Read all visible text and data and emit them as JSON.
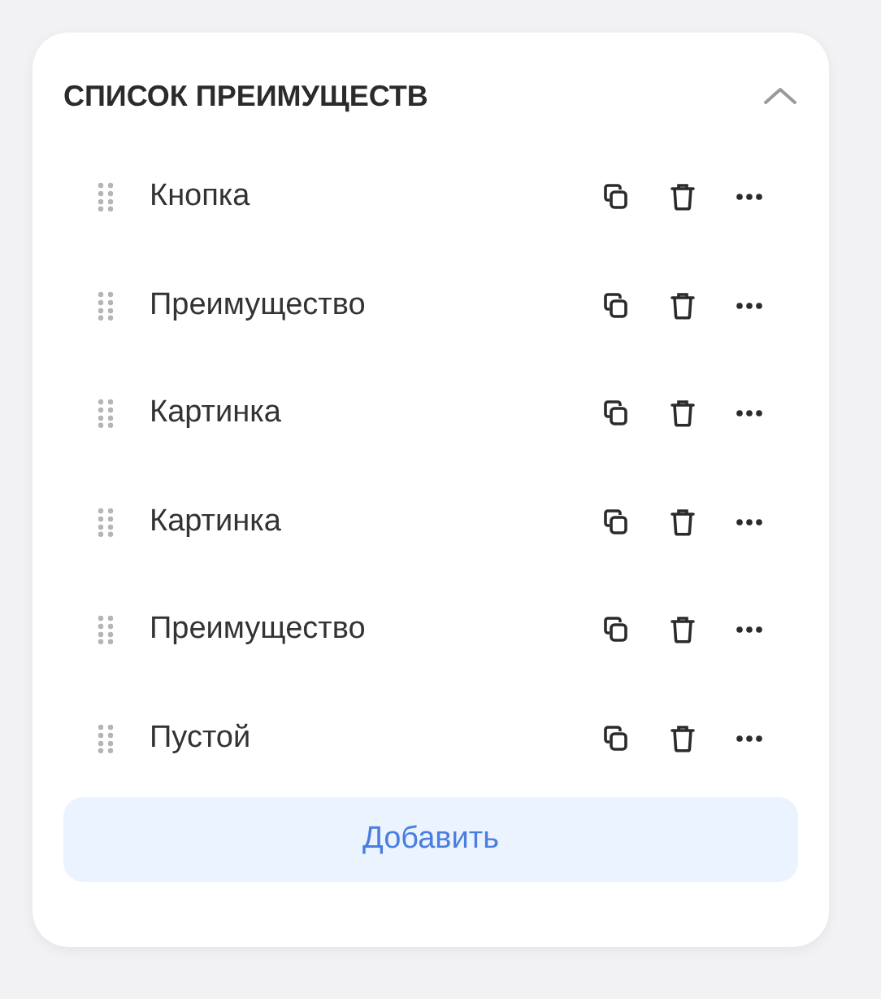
{
  "panel": {
    "title": "СПИСОК ПРЕИМУЩЕСТВ",
    "expanded": true
  },
  "items": [
    {
      "label": "Кнопка"
    },
    {
      "label": "Преимущество"
    },
    {
      "label": "Картинка"
    },
    {
      "label": "Картинка"
    },
    {
      "label": "Преимущество"
    },
    {
      "label": "Пустой"
    }
  ],
  "add_button": "Добавить"
}
